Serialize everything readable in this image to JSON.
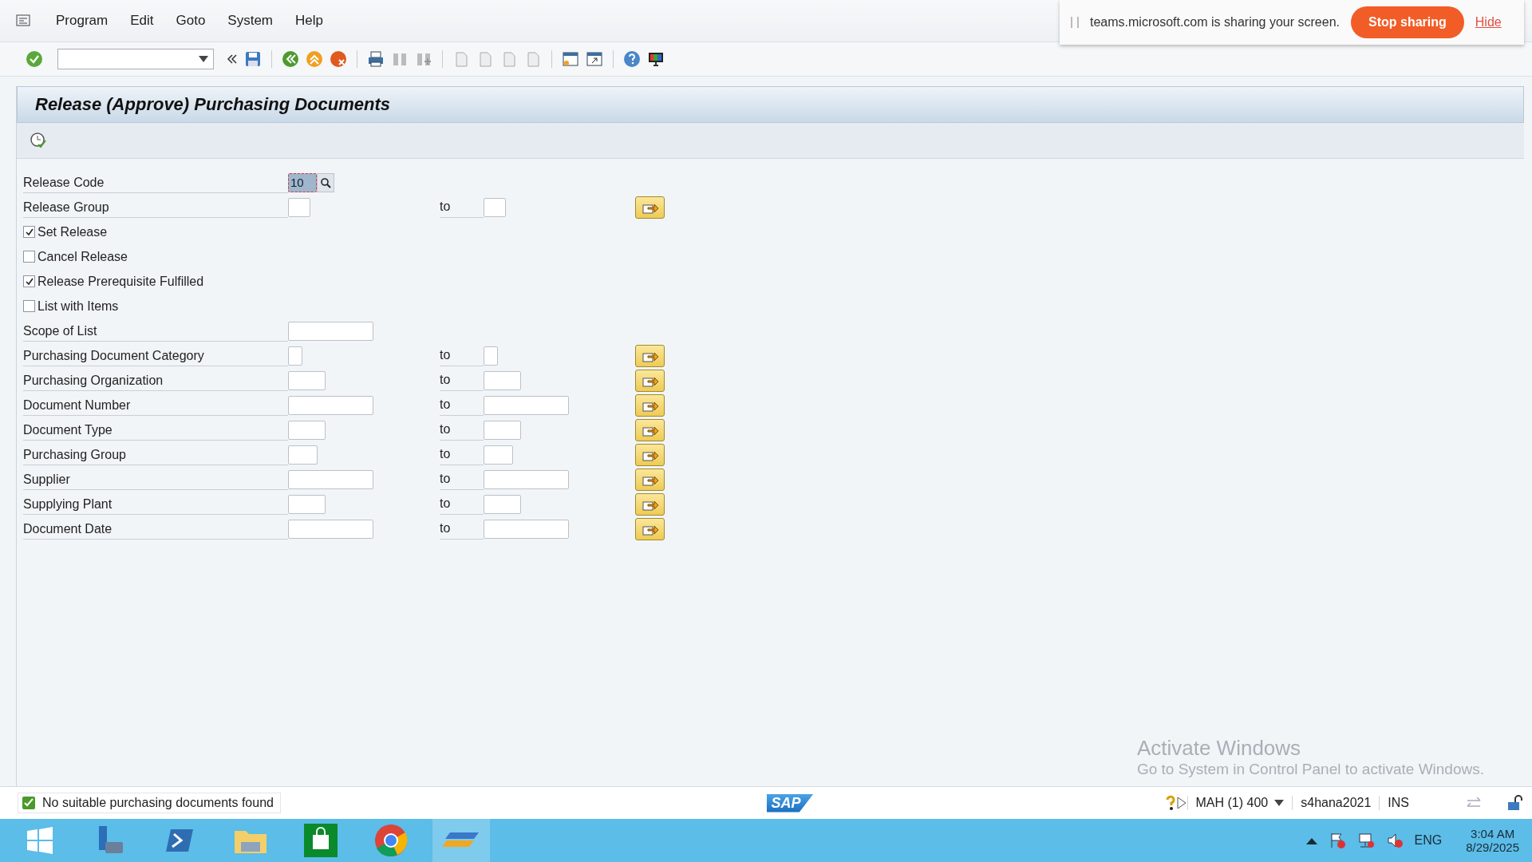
{
  "menu": [
    "Program",
    "Edit",
    "Goto",
    "System",
    "Help"
  ],
  "sharing": {
    "text": "teams.microsoft.com is sharing your screen.",
    "stop": "Stop sharing",
    "hide": "Hide"
  },
  "title": "Release (Approve) Purchasing Documents",
  "rows": [
    {
      "kind": "code",
      "label": "Release Code",
      "value": "10"
    },
    {
      "kind": "range",
      "label": "Release Group",
      "to": "to"
    },
    {
      "kind": "checkbox",
      "label": "Set Release",
      "checked": true
    },
    {
      "kind": "checkbox",
      "label": "Cancel Release",
      "checked": false
    },
    {
      "kind": "checkbox",
      "label": "Release Prerequisite Fulfilled",
      "checked": true
    },
    {
      "kind": "checkbox",
      "label": "List with Items",
      "checked": false
    },
    {
      "kind": "single",
      "label": "Scope of List"
    },
    {
      "kind": "range",
      "label": "Purchasing Document Category",
      "to": "to"
    },
    {
      "kind": "range",
      "label": "Purchasing Organization",
      "to": "to"
    },
    {
      "kind": "range",
      "label": "Document Number",
      "to": "to"
    },
    {
      "kind": "range",
      "label": "Document Type",
      "to": "to"
    },
    {
      "kind": "range",
      "label": "Purchasing Group",
      "to": "to"
    },
    {
      "kind": "range",
      "label": "Supplier",
      "to": "to"
    },
    {
      "kind": "range",
      "label": "Supplying Plant",
      "to": "to"
    },
    {
      "kind": "range",
      "label": "Document Date",
      "to": "to"
    }
  ],
  "activation": {
    "title": "Activate Windows",
    "text": "Go to System in Control Panel to activate Windows."
  },
  "status": {
    "message": "No suitable purchasing documents found",
    "logo": "SAP",
    "system": "MAH (1) 400",
    "server": "s4hana2021",
    "mode": "INS"
  },
  "tray": {
    "language": "ENG",
    "time": "3:04 AM",
    "date": "8/29/2025"
  }
}
